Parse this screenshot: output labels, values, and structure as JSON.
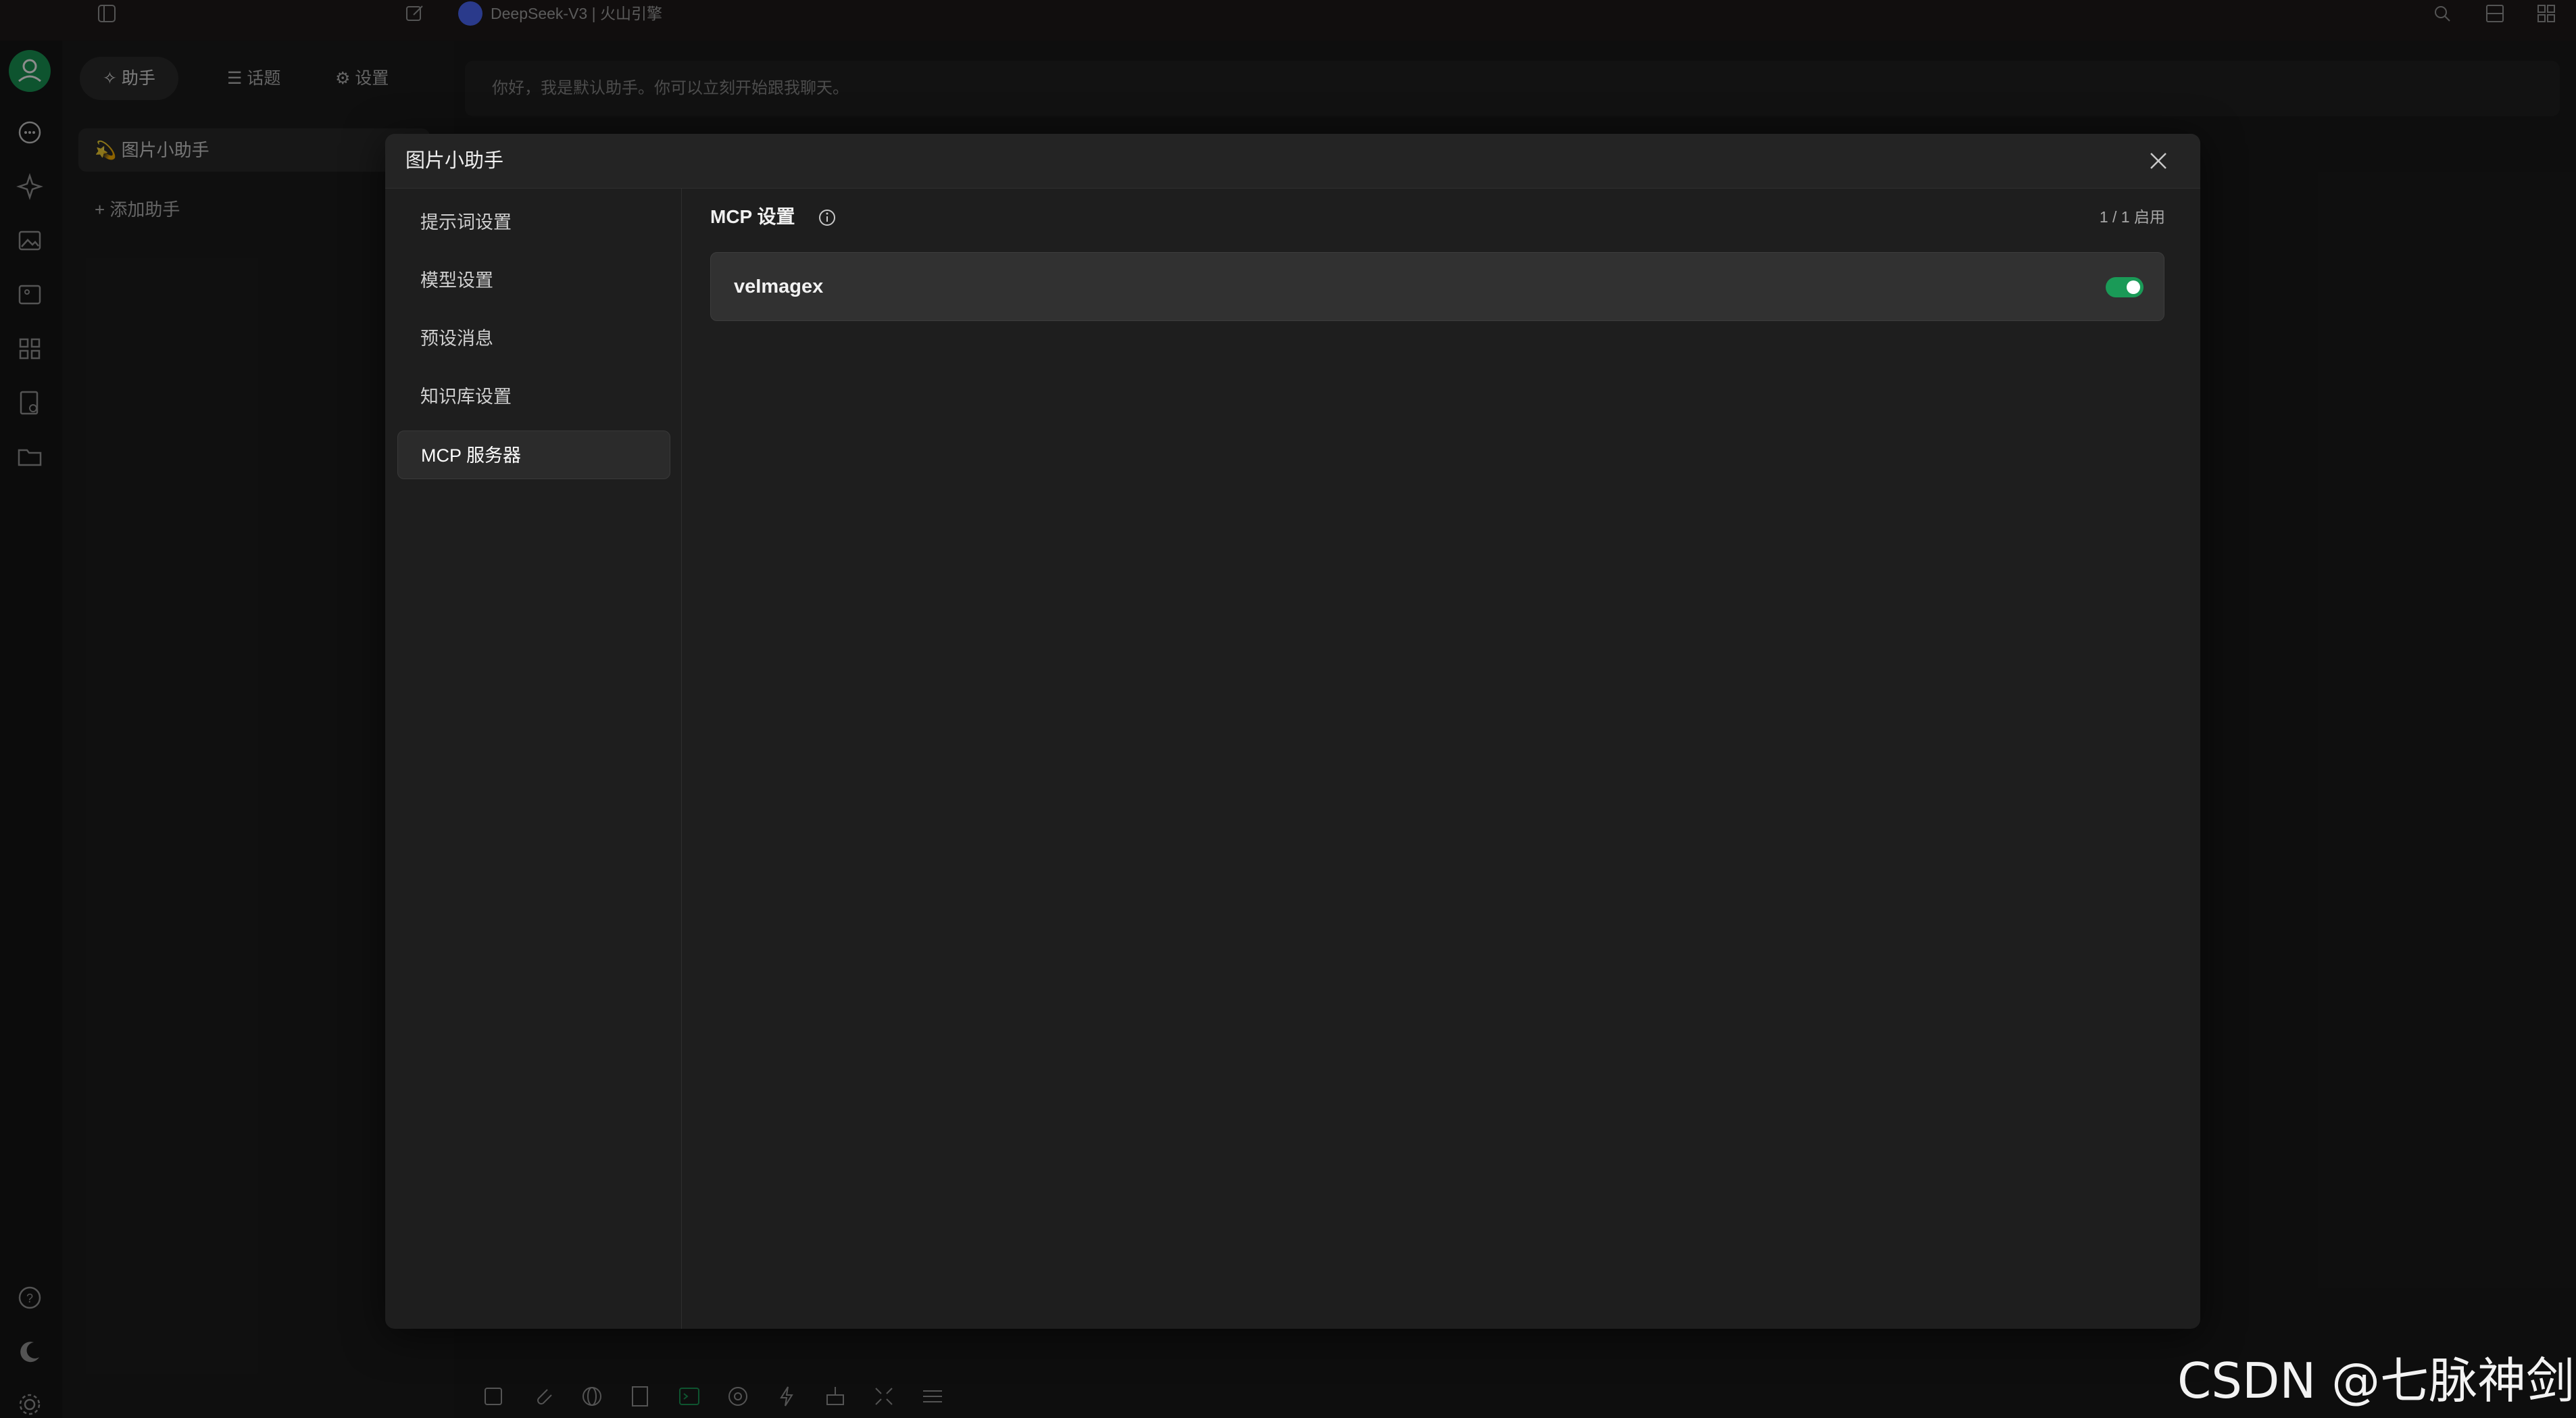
{
  "topbar": {
    "model_title": "DeepSeek-V3 | 火山引擎"
  },
  "assistants_panel": {
    "tabs": [
      {
        "label": "✧ 助手"
      },
      {
        "label": "☰ 话题"
      },
      {
        "label": "⚙ 设置"
      }
    ],
    "current_assistant": "💫 图片小助手",
    "add_assistant": "+ 添加助手"
  },
  "chat": {
    "welcome_message": "你好，我是默认助手。你可以立刻开始跟我聊天。"
  },
  "modal": {
    "title": "图片小助手",
    "nav": [
      {
        "label": "提示词设置"
      },
      {
        "label": "模型设置"
      },
      {
        "label": "预设消息"
      },
      {
        "label": "知识库设置"
      },
      {
        "label": "MCP 服务器"
      }
    ],
    "active_nav": "MCP 服务器",
    "section_title": "MCP 设置",
    "enabled_count": "1 / 1 启用",
    "servers": [
      {
        "name": "veImagex",
        "enabled": true
      }
    ]
  },
  "watermark": "CSDN @七脉神剑",
  "colors": {
    "accent": "#1a9a57",
    "background": "#1b1b1b",
    "modal": "#1e1e1e"
  }
}
